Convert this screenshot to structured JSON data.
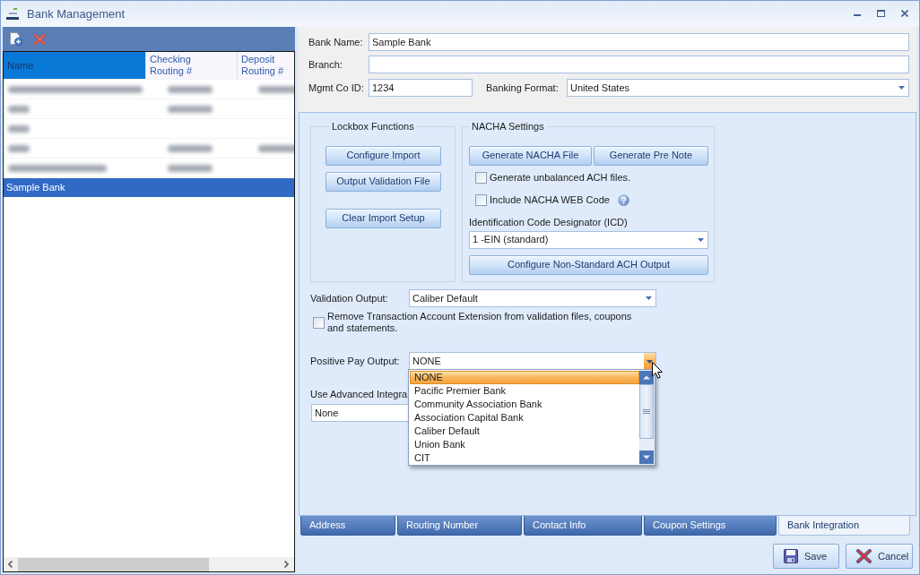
{
  "window": {
    "title": "Bank Management"
  },
  "bank_list": {
    "columns": [
      {
        "label": "Name",
        "selected": true
      },
      {
        "label": "Checking Routing #",
        "selected": false
      },
      {
        "label": "Deposit Routing #",
        "selected": false
      }
    ],
    "rows": [
      {
        "selected": false,
        "cells": [
          {
            "kind": "blurred_long"
          },
          {
            "kind": "blurred_medium"
          },
          {
            "kind": "blurred_medium"
          }
        ]
      },
      {
        "selected": false,
        "cells": [
          {
            "kind": "blurred_short"
          },
          {
            "kind": "blurred_medium"
          },
          {
            "kind": "blank"
          }
        ]
      },
      {
        "selected": false,
        "cells": [
          {
            "kind": "blurred_short"
          },
          {
            "kind": "blank"
          },
          {
            "kind": "blank"
          }
        ]
      },
      {
        "selected": false,
        "cells": [
          {
            "kind": "blurred_short"
          },
          {
            "kind": "blurred_medium"
          },
          {
            "kind": "blurred_medium"
          }
        ]
      },
      {
        "selected": false,
        "cells": [
          {
            "kind": "blurred_wide"
          },
          {
            "kind": "blurred_medium"
          },
          {
            "kind": "blank"
          }
        ]
      },
      {
        "selected": true,
        "cells": [
          {
            "kind": "text",
            "text": "Sample Bank"
          },
          {
            "kind": "blank"
          },
          {
            "kind": "blank"
          }
        ]
      }
    ]
  },
  "bank_details": {
    "bank_name": {
      "label": "Bank Name:",
      "value": "Sample Bank"
    },
    "branch": {
      "label": "Branch:"
    },
    "mgmt_co_id": {
      "label": "Mgmt Co ID:",
      "value": "1234"
    },
    "banking_format": {
      "label": "Banking Format:",
      "value": "United States"
    }
  },
  "bank_integration": {
    "lockbox_functions": {
      "title": "Lockbox Functions",
      "buttons": [
        "Configure Import",
        "Output Validation File",
        "Clear Import Setup"
      ]
    },
    "nacha_settings": {
      "title": "NACHA Settings",
      "buttons": [
        "Generate NACHA File",
        "Generate Pre Note"
      ],
      "checkboxes": [
        {
          "label": "Generate unbalanced ACH files.",
          "checked": false,
          "help": false
        },
        {
          "label": "Include NACHA WEB Code",
          "checked": false,
          "help": true
        }
      ],
      "icd": {
        "label": "Identification Code Designator (ICD)",
        "value": "1 -EIN (standard)"
      },
      "configure_button": "Configure Non-Standard ACH Output"
    },
    "validation_output": {
      "label": "Validation Output:",
      "value": "Caliber Default"
    },
    "remove_extension": {
      "label": "Remove Transaction Account Extension from validation files, coupons and statements.",
      "checked": false
    },
    "positive_pay_output": {
      "label": "Positive Pay Output:",
      "value": "NONE",
      "expanded": true,
      "options": [
        {
          "label": "NONE",
          "selected": true
        },
        {
          "label": "Pacific Premier Bank",
          "selected": false
        },
        {
          "label": "Community Association Bank",
          "selected": false
        },
        {
          "label": "Association Capital Bank",
          "selected": false
        },
        {
          "label": "Caliber Default",
          "selected": false
        },
        {
          "label": "Union Bank",
          "selected": false
        },
        {
          "label": "CIT",
          "selected": false
        }
      ]
    },
    "advanced_integration": {
      "label": "Use Advanced Integra",
      "value": "None"
    }
  },
  "tabs": [
    {
      "label": "Address",
      "selected": false
    },
    {
      "label": "Routing Number",
      "selected": false
    },
    {
      "label": "Contact Info",
      "selected": false
    },
    {
      "label": "Coupon Settings",
      "selected": false
    },
    {
      "label": "Bank Integration",
      "selected": true
    }
  ],
  "buttons": [
    {
      "kind": "save",
      "label": "Save"
    },
    {
      "kind": "cancel",
      "label": "Cancel"
    }
  ]
}
